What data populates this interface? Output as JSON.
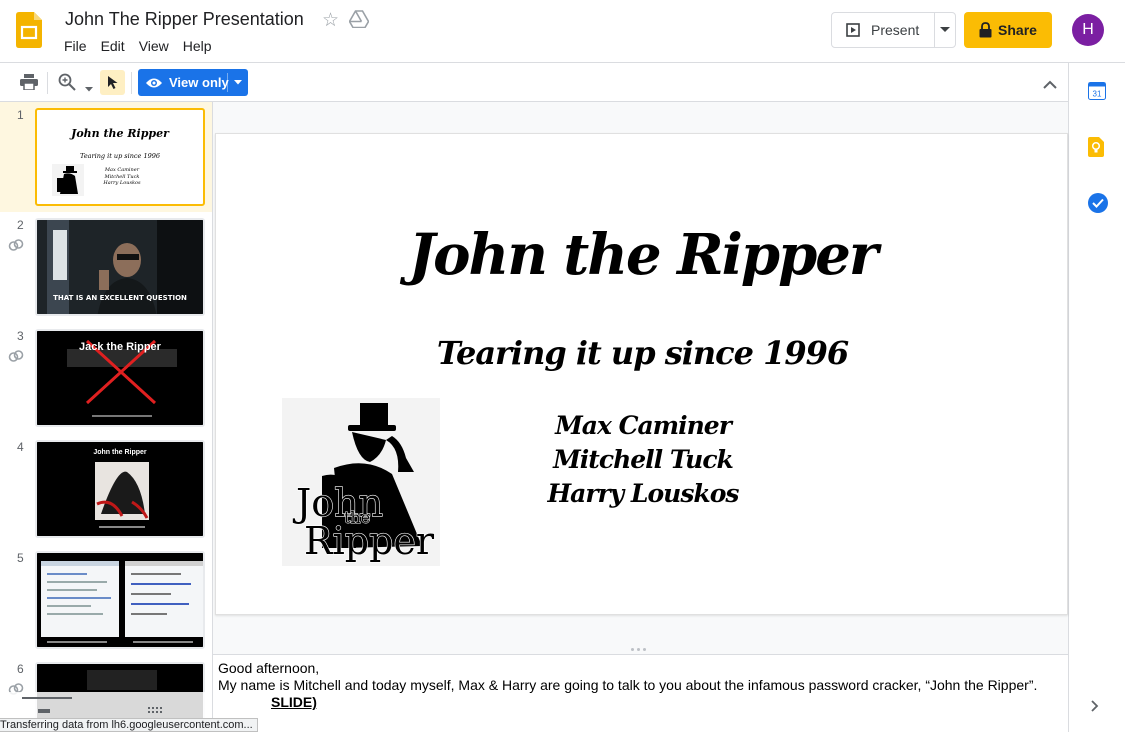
{
  "header": {
    "doc_title": "John The Ripper Presentation",
    "menu": [
      "File",
      "Edit",
      "View",
      "Help"
    ],
    "present_label": "Present",
    "share_label": "Share",
    "avatar_initial": "H"
  },
  "toolbar": {
    "view_mode_label": "View only"
  },
  "side_panel": {
    "calendar_day": "31"
  },
  "filmstrip": {
    "slides": [
      {
        "number": "1",
        "title": "John the Ripper",
        "subtitle": "Tearing it up since 1996",
        "names": [
          "Max Caminer",
          "Mitchell Tuck",
          "Harry Louskos"
        ]
      },
      {
        "number": "2",
        "caption": "THAT IS AN EXCELLENT QUESTION"
      },
      {
        "number": "3",
        "caption": "Jack the Ripper"
      },
      {
        "number": "4",
        "caption": "John the Ripper"
      },
      {
        "number": "5"
      },
      {
        "number": "6"
      }
    ]
  },
  "slide": {
    "title": "John the Ripper",
    "subtitle": "Tearing it up since 1996",
    "names": [
      "Max Caminer",
      "Mitchell Tuck",
      "Harry Louskos"
    ],
    "logo_text": [
      "John",
      "the",
      "Ripper"
    ]
  },
  "notes": {
    "line1": "Good afternoon,",
    "line2": "My name is Mitchell and today myself, Max & Harry are going to talk to you about the infamous password cracker, “John the Ripper”.",
    "line3": "SLIDE)"
  },
  "status": {
    "text": "Transferring data from lh6.googleusercontent.com..."
  }
}
